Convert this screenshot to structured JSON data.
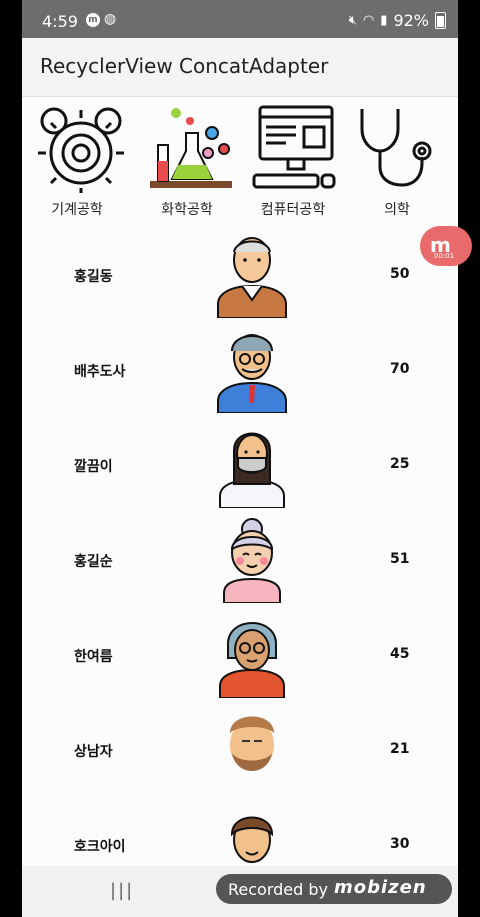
{
  "status": {
    "time": "4:59",
    "app_icon": "m",
    "battery": "92%"
  },
  "appbar": {
    "title": "RecyclerView ConcatAdapter"
  },
  "categories": [
    {
      "label": "기계공학",
      "icon": "gears-icon"
    },
    {
      "label": "화학공학",
      "icon": "chemistry-flask-icon"
    },
    {
      "label": "컴퓨터공학",
      "icon": "computer-icon"
    },
    {
      "label": "의학",
      "icon": "stethoscope-icon"
    }
  ],
  "people": [
    {
      "name": "홍길동",
      "age": "50",
      "avatar": "old-man-avatar"
    },
    {
      "name": "배추도사",
      "age": "70",
      "avatar": "grandpa-glasses-avatar"
    },
    {
      "name": "깔끔이",
      "age": "25",
      "avatar": "woman-mask-avatar"
    },
    {
      "name": "홍길순",
      "age": "51",
      "avatar": "grandma-avatar"
    },
    {
      "name": "한여름",
      "age": "45",
      "avatar": "woman-glasses-avatar"
    },
    {
      "name": "상남자",
      "age": "21",
      "avatar": "bearded-man-avatar"
    },
    {
      "name": "호크아이",
      "age": "30",
      "avatar": "young-man-avatar"
    }
  ],
  "recording": {
    "label": "Recorded by",
    "brand": "mobizen"
  },
  "side_bubble": {
    "letter": "m",
    "timer": "00:01"
  },
  "colors": {
    "appbar": "#f4f4f4",
    "statusbar": "#6d6d6d",
    "accent": "#e86a6a"
  }
}
